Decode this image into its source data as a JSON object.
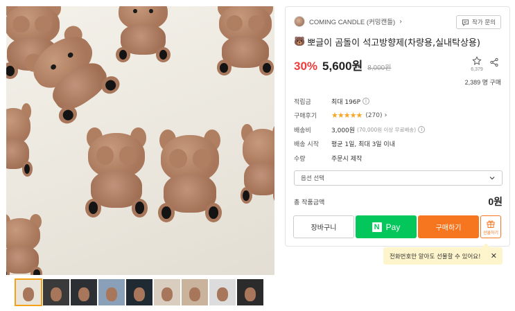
{
  "seller": {
    "name": "COMING CANDLE (커밍캔들)",
    "chevron": "›"
  },
  "ask_button": {
    "label": "작가 문의",
    "icon": "chat-icon"
  },
  "product": {
    "title_emoji": "🐻",
    "title": "뽀글이 곰돌이 석고방향제(차량용,실내탁상용)",
    "discount": "30%",
    "price": "5,600원",
    "original_price": "8,000원",
    "favorites": "6,379",
    "buyers": "2,389 명 구매"
  },
  "info": {
    "points": {
      "label": "적립금",
      "value": "최대 196P"
    },
    "reviews": {
      "label": "구매후기",
      "stars": "★★★★★",
      "rating": 5,
      "count": "(270)"
    },
    "shipping": {
      "label": "배송비",
      "value": "3,000원",
      "note": "(70,000원 이상 무료배송)"
    },
    "ship_start": {
      "label": "배송 시작",
      "value": "평균 1일, 최대 3일 이내"
    },
    "quantity": {
      "label": "수량",
      "value": "주문시 제작"
    }
  },
  "option": {
    "placeholder": "옵션 선택"
  },
  "total": {
    "label": "총 작품금액",
    "amount": "0원"
  },
  "buttons": {
    "cart": "장바구니",
    "npay_logo": "N",
    "npay": "Pay",
    "buy": "구매하기",
    "gift": "선물하기"
  },
  "tooltip": {
    "text": "전화번호만 알아도 선물할 수 있어요!",
    "close": "✕"
  },
  "thumbnails": [
    {
      "name": "thumb-1",
      "bg": "#e9e4da"
    },
    {
      "name": "thumb-2",
      "bg": "#3a3a3a"
    },
    {
      "name": "thumb-3",
      "bg": "#2c2f34"
    },
    {
      "name": "thumb-4",
      "bg": "#8aa0b8"
    },
    {
      "name": "thumb-5",
      "bg": "#1f2a33"
    },
    {
      "name": "thumb-6",
      "bg": "#d8cdbf"
    },
    {
      "name": "thumb-7",
      "bg": "#c9b39d"
    },
    {
      "name": "thumb-8",
      "bg": "#dcdcdc"
    },
    {
      "name": "thumb-9",
      "bg": "#2b2b2b"
    }
  ],
  "colors": {
    "discount": "#ee3b3b",
    "npay": "#03c75a",
    "buy": "#f5761f",
    "star": "#f5a623",
    "tooltip_bg": "#fff5cc"
  }
}
